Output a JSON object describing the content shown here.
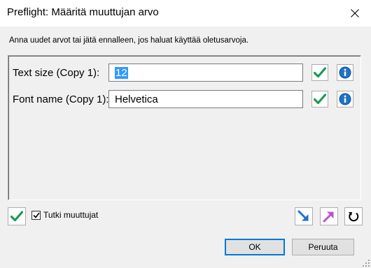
{
  "window": {
    "title": "Preflight: Määritä muuttujan arvo",
    "close_icon": "close-icon"
  },
  "instruction": "Anna uudet arvot tai jätä ennalleen, jos haluat käyttää oletusarvoja.",
  "rows": [
    {
      "label": "Text size (Copy 1):",
      "value": "12",
      "selected": true,
      "apply_icon": "checkmark-icon",
      "info_icon": "info-icon"
    },
    {
      "label": "Font name (Copy 1):",
      "value": "Helvetica",
      "selected": false,
      "apply_icon": "checkmark-icon",
      "info_icon": "info-icon"
    }
  ],
  "bottom": {
    "apply_all_icon": "checkmark-icon",
    "checkbox_label": "Tutki muuttujat",
    "checkbox_checked": true,
    "import_icon": "arrow-down-right-icon",
    "export_icon": "arrow-up-right-icon",
    "reset_icon": "reset-icon"
  },
  "buttons": {
    "ok": "OK",
    "cancel": "Peruuta"
  },
  "colors": {
    "check_green": "#1a9a55",
    "info_blue": "#1e73c8",
    "selection_blue": "#3399ff",
    "default_button_border": "#0078d7"
  }
}
